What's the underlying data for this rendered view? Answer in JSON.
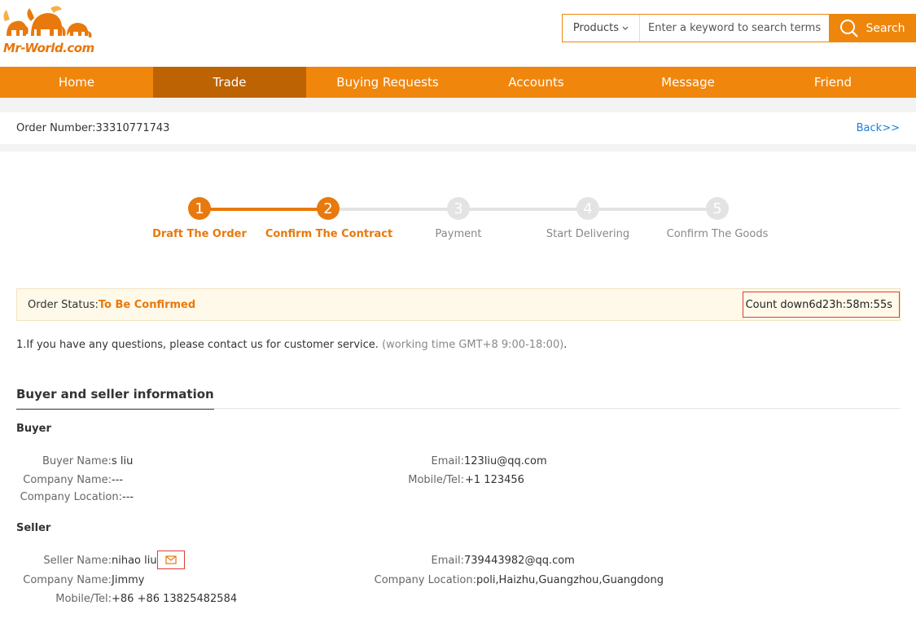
{
  "header": {
    "logo_text": "Mr-World.com",
    "search": {
      "category": "Products",
      "placeholder": "Enter a keyword to search terms",
      "button_label": "Search"
    }
  },
  "nav": {
    "items": [
      "Home",
      "Trade",
      "Buying Requests",
      "Accounts",
      "Message",
      "Friend"
    ],
    "active": "Trade"
  },
  "order": {
    "number_label": "Order Number:",
    "number": "33310771743",
    "back_label": "Back>>"
  },
  "steps": [
    {
      "num": "1",
      "label": "Draft The Order",
      "state": "done"
    },
    {
      "num": "2",
      "label": "Confirm The Contract",
      "state": "done"
    },
    {
      "num": "3",
      "label": "Payment",
      "state": "pending"
    },
    {
      "num": "4",
      "label": "Start Delivering",
      "state": "pending"
    },
    {
      "num": "5",
      "label": "Confirm The Goods",
      "state": "pending"
    }
  ],
  "status": {
    "label": "Order Status:",
    "value": "To Be Confirmed",
    "countdown_label": "Count down",
    "countdown_value": "6d23h:58m:55s"
  },
  "note": {
    "text": "1.If you have any questions, please contact us for customer service. ",
    "hours": "(working time GMT+8 9:00-18:00)",
    "end": "."
  },
  "info": {
    "section_title": "Buyer and seller information",
    "buyer": {
      "title": "Buyer",
      "name_label": "Buyer Name:",
      "name": "s liu",
      "email_label": "Email:",
      "email": "123liu@qq.com",
      "company_label": "Company Name:",
      "company": "---",
      "mobile_label": "Mobile/Tel:",
      "mobile": "+1 123456",
      "location_label": "Company Location:",
      "location": "---"
    },
    "seller": {
      "title": "Seller",
      "name_label": "Seller Name:",
      "name": "nihao liu",
      "email_label": "Email:",
      "email": "739443982@qq.com",
      "company_label": "Company Name:",
      "company": "Jimmy",
      "location_label": "Company Location:",
      "location": "poli,Haizhu,Guangzhou,Guangdong",
      "mobile_label": "Mobile/Tel:",
      "mobile": "+86 +86 13825482584"
    }
  },
  "colors": {
    "brand": "#f0860c",
    "nav_active": "#bd6303",
    "step_done": "#e8790c",
    "step_pending": "#e3e3e3",
    "highlight_border": "#e03b3b",
    "link": "#1e7fd6"
  }
}
